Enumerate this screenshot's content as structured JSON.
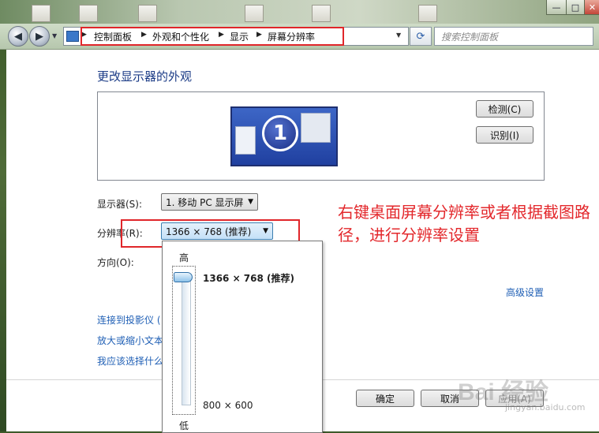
{
  "breadcrumb": {
    "items": [
      "控制面板",
      "外观和个性化",
      "显示",
      "屏幕分辨率"
    ]
  },
  "search": {
    "placeholder": "搜索控制面板"
  },
  "page": {
    "heading": "更改显示器的外观"
  },
  "monitor_preview": {
    "number": "1"
  },
  "buttons": {
    "detect": "检测(C)",
    "identify": "识别(I)",
    "ok": "确定",
    "cancel": "取消",
    "apply": "应用(A)"
  },
  "display": {
    "label": "显示器(S):",
    "value": "1. 移动 PC 显示屏"
  },
  "resolution": {
    "label": "分辨率(R):",
    "value": "1366 × 768 (推荐)",
    "dropdown": {
      "high_label": "高",
      "low_label": "低",
      "top_option": "1366 × 768 (推荐)",
      "bottom_option": "800 × 600",
      "slider_position": "top"
    }
  },
  "orientation": {
    "label": "方向(O):"
  },
  "advanced_link": "高级设置",
  "links": [
    "连接到投影仪 (",
    "放大或缩小文本",
    "我应该选择什么"
  ],
  "annotation": {
    "text": "右键桌面屏幕分辨率或者根据截图路径，进行分辨率设置"
  },
  "watermark": {
    "text": "Bai 经验",
    "sub": "jingyan.baidu.com"
  },
  "colors": {
    "link": "#1f5fb5",
    "heading": "#1b3b86",
    "annotation": "#e3282c",
    "highlight_box": "#e0262a"
  }
}
